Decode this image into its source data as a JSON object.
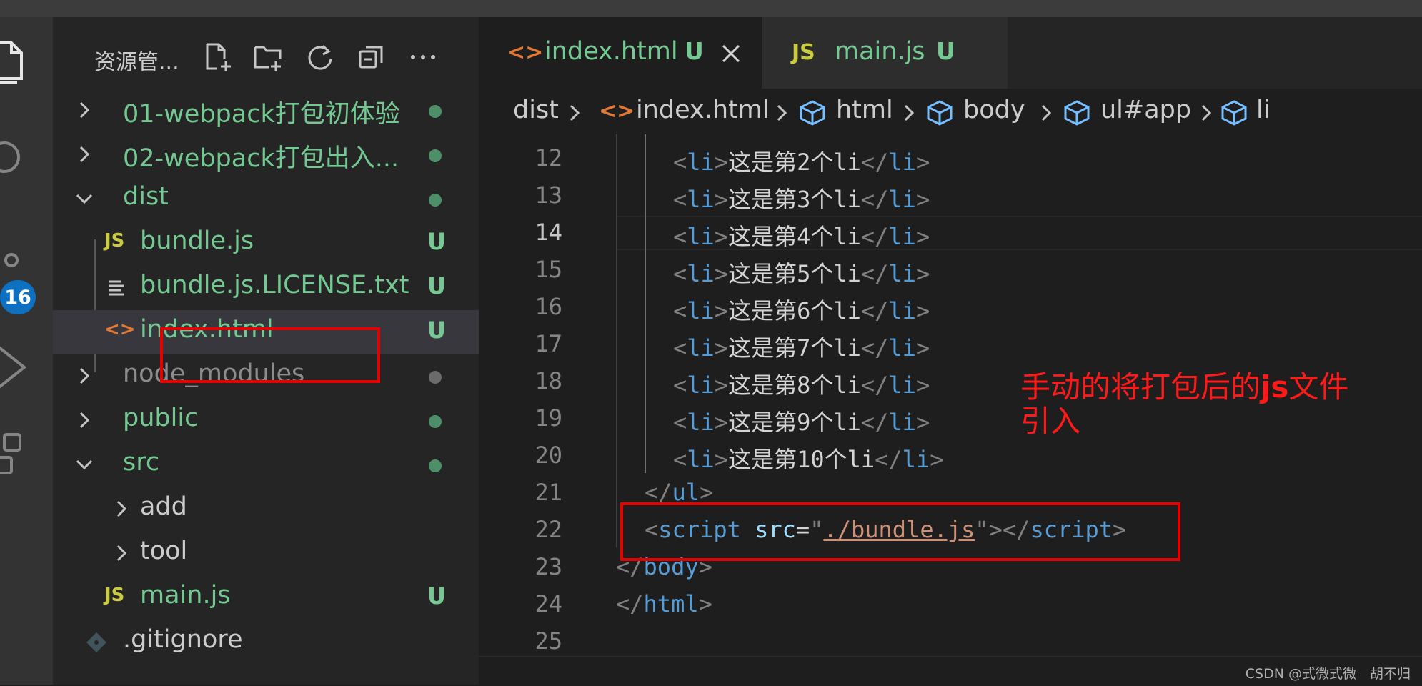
{
  "explorer": {
    "title": "资源管...",
    "items": [
      {
        "label": "01-webpack打包初体验",
        "status": "dot",
        "kind": "folder",
        "expanded": false
      },
      {
        "label": "02-webpack打包出入...",
        "status": "dot",
        "kind": "folder",
        "expanded": false
      },
      {
        "label": "dist",
        "status": "dot",
        "kind": "folder",
        "expanded": true
      },
      {
        "label": "bundle.js",
        "status": "U",
        "kind": "file",
        "icon": "JS"
      },
      {
        "label": "bundle.js.LICENSE.txt",
        "status": "U",
        "kind": "file"
      },
      {
        "label": "index.html",
        "status": "U",
        "kind": "file",
        "icon": "<>",
        "selected": true
      },
      {
        "label": "node_modules",
        "status": "dot",
        "kind": "folder",
        "expanded": false
      },
      {
        "label": "public",
        "status": "dot",
        "kind": "folder",
        "expanded": false
      },
      {
        "label": "src",
        "status": "dot",
        "kind": "folder",
        "expanded": true
      },
      {
        "label": "add",
        "kind": "folder",
        "expanded": false
      },
      {
        "label": "tool",
        "kind": "folder",
        "expanded": false
      },
      {
        "label": "main.js",
        "status": "U",
        "kind": "file",
        "icon": "JS"
      },
      {
        "label": ".gitignore",
        "kind": "file"
      }
    ]
  },
  "activity": {
    "badge": "16"
  },
  "tabs": [
    {
      "icon": "<>",
      "label": "index.html",
      "status": "U",
      "active": true
    },
    {
      "icon": "JS",
      "label": "main.js",
      "status": "U",
      "active": false
    }
  ],
  "breadcrumb": [
    "dist",
    "index.html",
    "html",
    "body",
    "ul#app",
    "li"
  ],
  "editor": {
    "lines": [
      {
        "n": "12",
        "text": "这是第2个li"
      },
      {
        "n": "13",
        "text": "这是第3个li"
      },
      {
        "n": "14",
        "text": "这是第4个li"
      },
      {
        "n": "15",
        "text": "这是第5个li"
      },
      {
        "n": "16",
        "text": "这是第6个li"
      },
      {
        "n": "17",
        "text": "这是第7个li"
      },
      {
        "n": "18",
        "text": "这是第8个li"
      },
      {
        "n": "19",
        "text": "这是第9个li"
      },
      {
        "n": "20",
        "text": "这是第10个li"
      },
      {
        "n": "21"
      },
      {
        "n": "22"
      },
      {
        "n": "23"
      },
      {
        "n": "24"
      },
      {
        "n": "25"
      }
    ],
    "script_src": "./bundle.js",
    "active_line": "14"
  },
  "annotation": {
    "prefix": "手动的将打包后的",
    "bold": "js",
    "suffix": "文件",
    "line2": "引入"
  },
  "watermark": "CSDN @式微式微　胡不归",
  "colors": {
    "untracked": "#73c991",
    "annotation": "#ff1a1a",
    "highlight_box": "#e60000",
    "badge": "#0e70c0"
  }
}
